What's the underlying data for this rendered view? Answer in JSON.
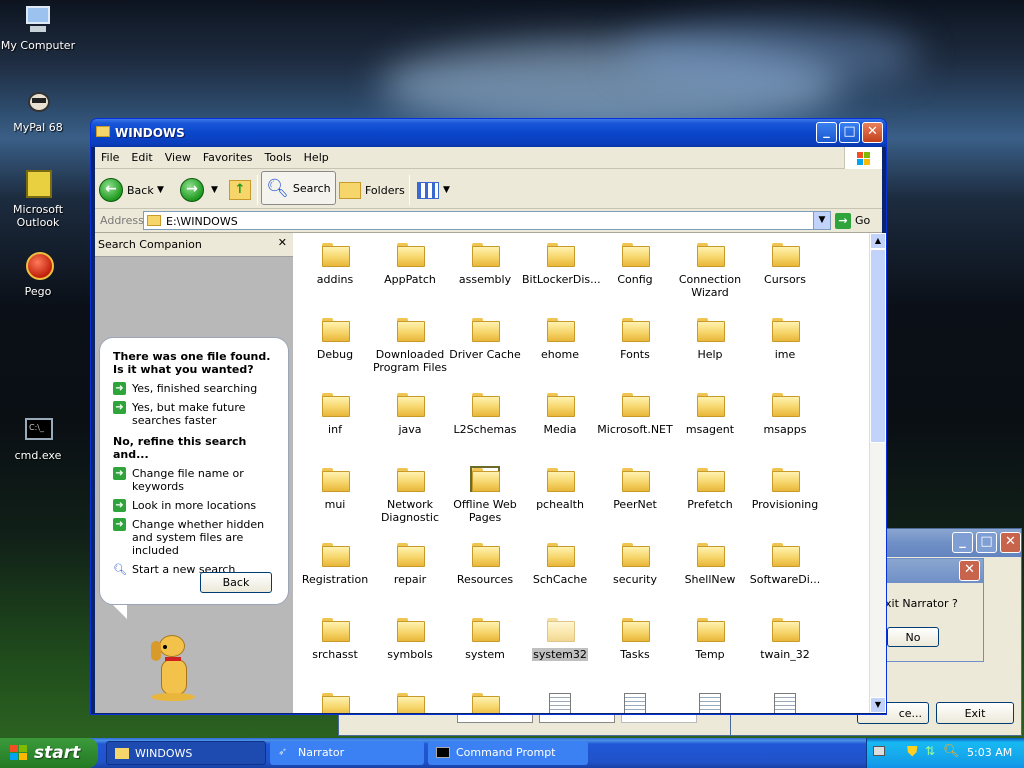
{
  "desktop": {
    "icons": [
      {
        "label": "My Computer"
      },
      {
        "label": "MyPal 68"
      },
      {
        "label": "Microsoft Outlook"
      },
      {
        "label": "Pego"
      },
      {
        "label": "cmd.exe"
      }
    ]
  },
  "window": {
    "title": "WINDOWS"
  },
  "menu": [
    "File",
    "Edit",
    "View",
    "Favorites",
    "Tools",
    "Help"
  ],
  "toolbar": {
    "back": "Back",
    "search": "Search",
    "folders": "Folders"
  },
  "address": {
    "label": "Address",
    "value": "E:\\WINDOWS",
    "go": "Go"
  },
  "companion": {
    "title": "Search Companion",
    "question": "There was one file found.  Is it what you wanted?",
    "opt1": "Yes, finished searching",
    "opt2": "Yes, but make future searches faster",
    "refine": "No, refine this search and...",
    "opt3": "Change file name or keywords",
    "opt4": "Look in more locations",
    "opt5": "Change whether hidden and system files are included",
    "opt6": "Start a new search",
    "back": "Back"
  },
  "files": [
    "addins",
    "AppPatch",
    "assembly",
    "BitLockerDis...",
    "Config",
    "Connection Wizard",
    "Cursors",
    "Debug",
    "Downloaded Program Files",
    "Driver Cache",
    "ehome",
    "Fonts",
    "Help",
    "ime",
    "inf",
    "java",
    "L2Schemas",
    "Media",
    "Microsoft.NET",
    "msagent",
    "msapps",
    "mui",
    "Network Diagnostic",
    "Offline Web Pages",
    "pchealth",
    "PeerNet",
    "Prefetch",
    "Provisioning",
    "Registration",
    "repair",
    "Resources",
    "SchCache",
    "security",
    "ShellNew",
    "SoftwareDi...",
    "srchasst",
    "symbols",
    "system",
    "system32",
    "Tasks",
    "Temp",
    "twain_32"
  ],
  "narrator": {
    "prompt": "xit Narrator ?",
    "no": "No",
    "exit": "Exit",
    "ce": "ce..."
  },
  "taskbar": {
    "start": "start",
    "tasks": [
      "WINDOWS",
      "Narrator",
      "Command Prompt"
    ],
    "clock": "5:03 AM"
  }
}
